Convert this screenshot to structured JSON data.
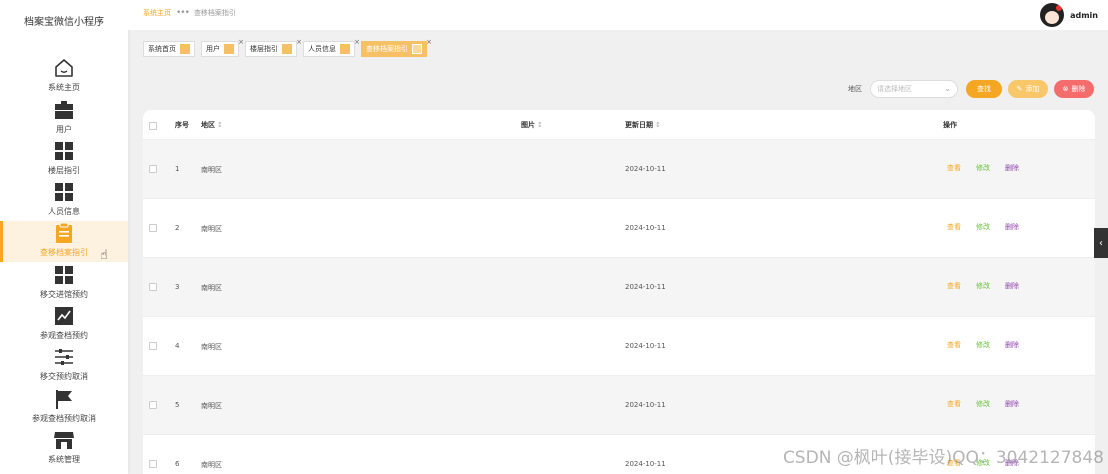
{
  "app_title": "档案宝微信小程序",
  "nav": [
    {
      "label": "系统主页",
      "icon": "home-icon"
    },
    {
      "label": "用户",
      "icon": "briefcase-icon"
    },
    {
      "label": "楼层指引",
      "icon": "grid-icon"
    },
    {
      "label": "人员信息",
      "icon": "grid-icon"
    },
    {
      "label": "查移档案指引",
      "icon": "clipboard-icon",
      "active": true
    },
    {
      "label": "移交进馆预约",
      "icon": "grid-icon"
    },
    {
      "label": "参观查档预约",
      "icon": "chart-icon"
    },
    {
      "label": "移交预约取消",
      "icon": "sliders-icon"
    },
    {
      "label": "参观查档预约取消",
      "icon": "flag-icon"
    },
    {
      "label": "系统管理",
      "icon": "store-icon"
    }
  ],
  "breadcrumb": {
    "home": "系统主页",
    "current": "查移档案指引"
  },
  "user": {
    "name": "admin"
  },
  "tags": [
    {
      "label": "系统首页"
    },
    {
      "label": "用户"
    },
    {
      "label": "楼层指引"
    },
    {
      "label": "人员信息"
    },
    {
      "label": "查移档案指引",
      "active": true
    }
  ],
  "filter": {
    "label": "地区",
    "placeholder": "请选择地区",
    "search": "查找",
    "add": "添加",
    "delete": "删除"
  },
  "table": {
    "headers": {
      "index": "序号",
      "region": "地区",
      "image": "图片",
      "updated": "更新日期",
      "actions": "操作"
    },
    "action_labels": {
      "view": "查看",
      "edit": "修改",
      "delete": "删除"
    },
    "rows": [
      {
        "index": "1",
        "region": "南明区",
        "updated": "2024-10-11"
      },
      {
        "index": "2",
        "region": "南明区",
        "updated": "2024-10-11"
      },
      {
        "index": "3",
        "region": "南明区",
        "updated": "2024-10-11"
      },
      {
        "index": "4",
        "region": "南明区",
        "updated": "2024-10-11"
      },
      {
        "index": "5",
        "region": "南明区",
        "updated": "2024-10-11"
      },
      {
        "index": "6",
        "region": "南明区",
        "updated": "2024-10-11"
      }
    ]
  },
  "watermark": "CSDN @枫叶(接毕设)QQ：3042127848",
  "colors": {
    "accent": "#f5a623",
    "danger": "#f56c6c",
    "success": "#67c23a",
    "purple": "#8e44ad"
  }
}
